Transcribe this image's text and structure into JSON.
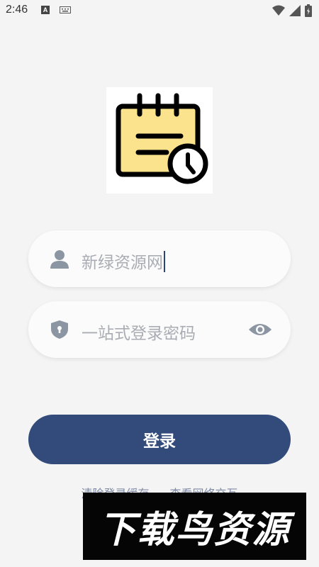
{
  "status_bar": {
    "time": "2:46",
    "notification_letter": "A"
  },
  "login_form": {
    "username_value": "新绿资源网",
    "password_placeholder": "一站式登录密码",
    "login_button": "登录"
  },
  "links": {
    "clear_cache": "清除登录缓存",
    "view_network": "查看网络交互"
  },
  "watermark_text": "下载鸟资源",
  "colors": {
    "primary": "#324b7a",
    "background": "#f4f4f4",
    "logo_yellow": "#fbe28c"
  }
}
